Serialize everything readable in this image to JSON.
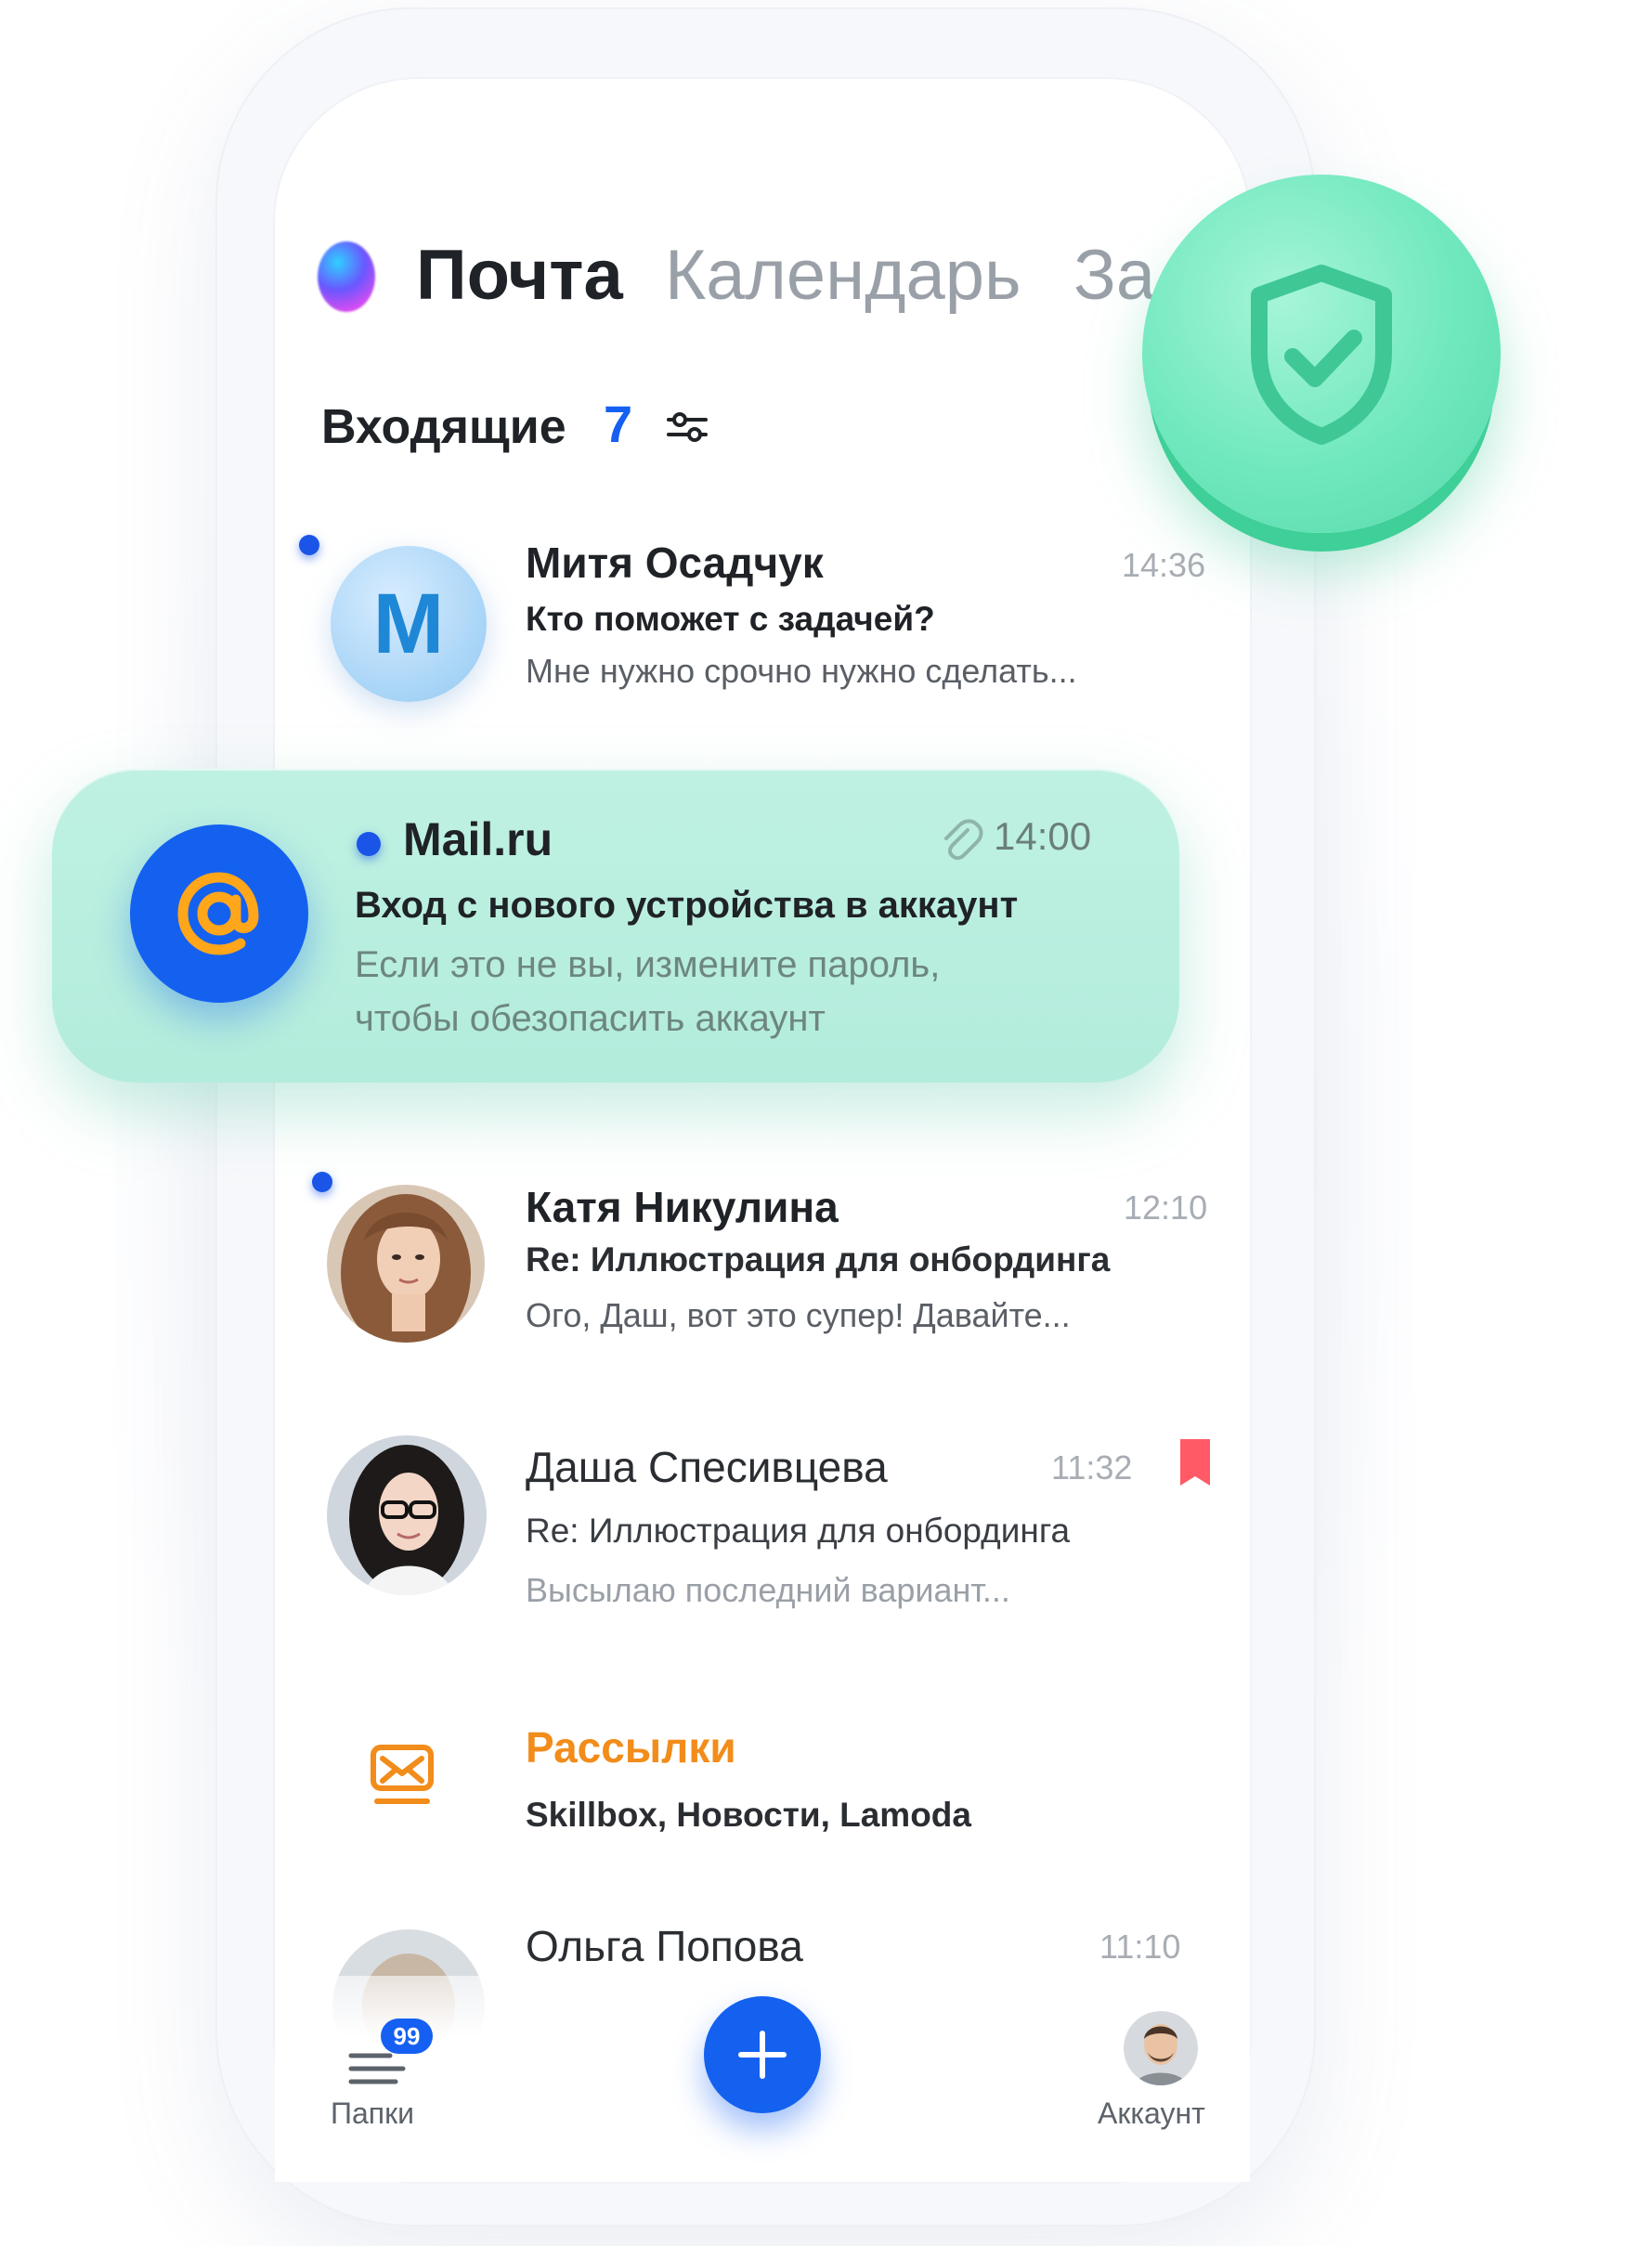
{
  "tabs": [
    {
      "label": "Почта",
      "active": true
    },
    {
      "label": "Календарь",
      "active": false
    },
    {
      "label": "За",
      "active": false
    }
  ],
  "folder": {
    "title": "Входящие",
    "count": "7"
  },
  "messages": [
    {
      "sender": "Митя Осадчук",
      "avatar_letter": "М",
      "subject": "Кто поможет с задачей?",
      "preview": "Мне нужно срочно нужно сделать...",
      "time": "14:36",
      "unread": true
    },
    {
      "sender": "Mail.ru",
      "subject": "Вход с нового устройства в аккаунт",
      "preview_line1": "Если это не вы, измените пароль,",
      "preview_line2": "чтобы обезопасить аккаунт",
      "time": "14:00",
      "unread": true,
      "has_attachment": true,
      "highlighted": true
    },
    {
      "sender": "Катя Никулина",
      "subject": "Re: Иллюстрация для онбординга",
      "preview": "Ого, Даш, вот это супер! Давайте...",
      "time": "12:10",
      "unread": true
    },
    {
      "sender": "Даша Спесивцева",
      "subject": "Re: Иллюстрация для онбординга",
      "preview": "Высылаю последний вариант...",
      "time": "11:32",
      "unread": false,
      "bookmarked": true
    },
    {
      "sender": "Рассылки",
      "subject": "Skillbox, Новости, Lamoda",
      "icon": "newsletter-icon"
    },
    {
      "sender": "Ольга Попова",
      "time": "11:10"
    }
  ],
  "bottom_nav": {
    "folders_label": "Папки",
    "folders_badge": "99",
    "compose_icon": "plus-icon",
    "account_label": "Аккаунт"
  },
  "colors": {
    "accent": "#1461f0",
    "highlight_card": "#b8eedf",
    "shield_badge": "#6fe8bd",
    "newsletter_orange": "#f28c1a",
    "bookmark_red": "#ff5a66"
  }
}
